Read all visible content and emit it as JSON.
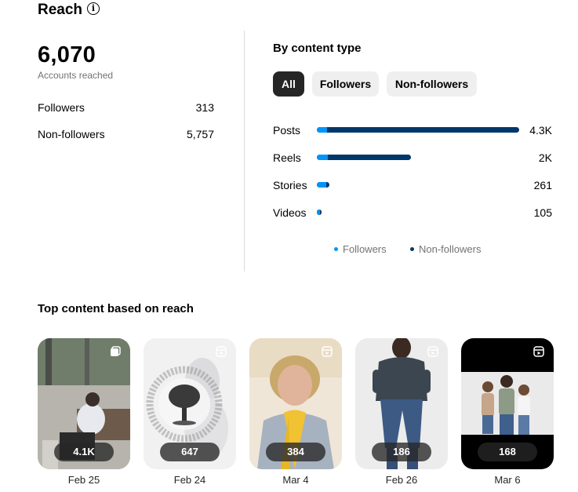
{
  "header": {
    "title": "Reach",
    "info_icon": "info-circle-icon"
  },
  "summary": {
    "total": "6,070",
    "total_label": "Accounts reached",
    "rows": [
      {
        "label": "Followers",
        "value": "313"
      },
      {
        "label": "Non-followers",
        "value": "5,757"
      }
    ]
  },
  "by_content_type": {
    "title": "By content type",
    "filters": [
      "All",
      "Followers",
      "Non-followers"
    ],
    "selected_filter": "All",
    "legend": [
      "Followers",
      "Non-followers"
    ],
    "colors": {
      "followers": "#0095f6",
      "non_followers": "#00376b"
    }
  },
  "chart_data": {
    "type": "bar",
    "orientation": "horizontal",
    "stacked": true,
    "categories": [
      "Posts",
      "Reels",
      "Stories",
      "Videos"
    ],
    "value_labels": [
      "4.3K",
      "2K",
      "261",
      "105"
    ],
    "values": [
      4300,
      2000,
      261,
      105
    ],
    "series": [
      {
        "name": "Followers",
        "values": [
          50,
          60,
          30,
          8
        ]
      },
      {
        "name": "Non-followers",
        "values": [
          4250,
          1940,
          231,
          97
        ]
      }
    ]
  },
  "top_content": {
    "title": "Top content based on reach",
    "items": [
      {
        "reach": "4.1K",
        "date": "Feb 25",
        "icon": "carousel-icon"
      },
      {
        "reach": "647",
        "date": "Feb 24",
        "icon": "reel-icon"
      },
      {
        "reach": "384",
        "date": "Mar 4",
        "icon": "reel-icon"
      },
      {
        "reach": "186",
        "date": "Feb 26",
        "icon": "reel-icon"
      },
      {
        "reach": "168",
        "date": "Mar 6",
        "icon": "reel-icon"
      }
    ]
  }
}
